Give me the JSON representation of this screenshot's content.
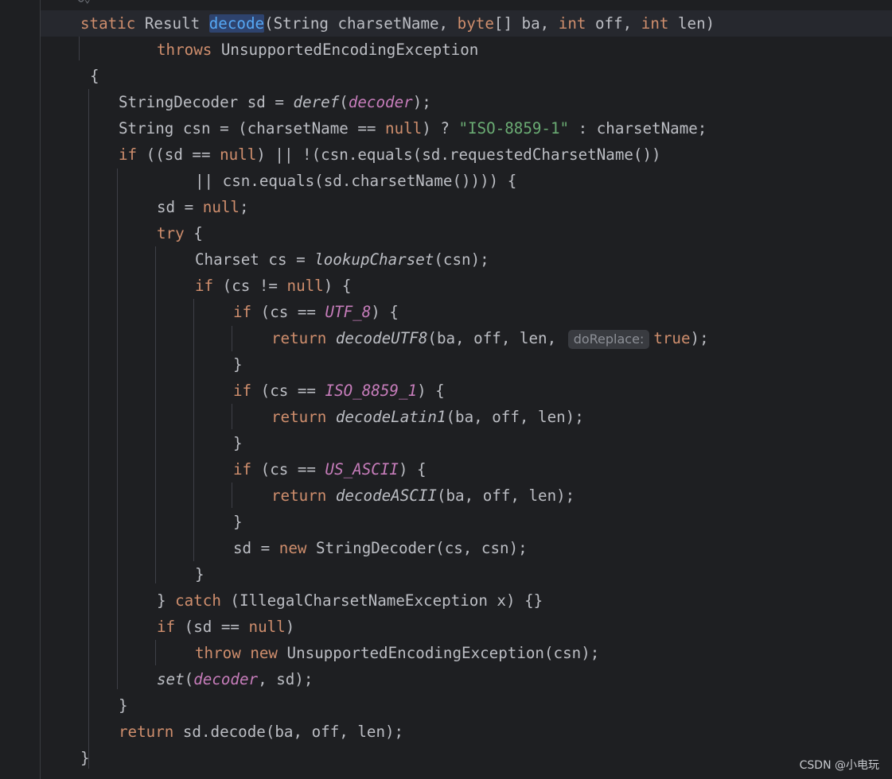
{
  "editor": {
    "gutter_fold_marker": "-",
    "inline_hint": "doReplace:",
    "method_name": "decode",
    "lines": [
      [
        "static",
        "Result",
        "decode",
        "(String charsetName,",
        "byte",
        "[] ba,",
        "int",
        "off,",
        "int",
        "len)"
      ],
      [
        "throws",
        "UnsupportedEncodingException"
      ],
      [
        "{"
      ],
      [
        "StringDecoder sd = ",
        "deref",
        "(",
        "decoder",
        ");"
      ],
      [
        "String csn = (charsetName == ",
        "null",
        ") ? ",
        "\"ISO-8859-1\"",
        " : charsetName;"
      ],
      [
        "if",
        " ((sd == ",
        "null",
        ") || !(csn.equals(sd.requestedCharsetName())"
      ],
      [
        "|| csn.equals(sd.charsetName()))) {"
      ],
      [
        "sd = ",
        "null",
        ";"
      ],
      [
        "try",
        " {"
      ],
      [
        "Charset cs = ",
        "lookupCharset",
        "(csn);"
      ],
      [
        "if",
        " (cs != ",
        "null",
        ") {"
      ],
      [
        "if",
        " (cs == ",
        "UTF_8",
        ") {"
      ],
      [
        "return",
        " ",
        "decodeUTF8",
        "(ba, off, len,",
        "true",
        ");"
      ],
      [
        "}"
      ],
      [
        "if",
        " (cs == ",
        "ISO_8859_1",
        ") {"
      ],
      [
        "return",
        " ",
        "decodeLatin1",
        "(ba, off, len);"
      ],
      [
        "}"
      ],
      [
        "if",
        " (cs == ",
        "US_ASCII",
        ") {"
      ],
      [
        "return",
        " ",
        "decodeASCII",
        "(ba, off, len);"
      ],
      [
        "}"
      ],
      [
        "sd = ",
        "new",
        " StringDecoder(cs, csn);"
      ],
      [
        "}"
      ],
      [
        "} ",
        "catch",
        " (IllegalCharsetNameException x) {}"
      ],
      [
        "if",
        " (sd == ",
        "null",
        ")"
      ],
      [
        "throw",
        " ",
        "new",
        " UnsupportedEncodingException(csn);"
      ],
      [
        "set",
        "(",
        "decoder",
        ", sd);"
      ],
      [
        "}"
      ],
      [
        "return",
        " sd.decode(ba, off, len);"
      ],
      [
        "}"
      ]
    ]
  },
  "watermark": "CSDN @小电玩"
}
